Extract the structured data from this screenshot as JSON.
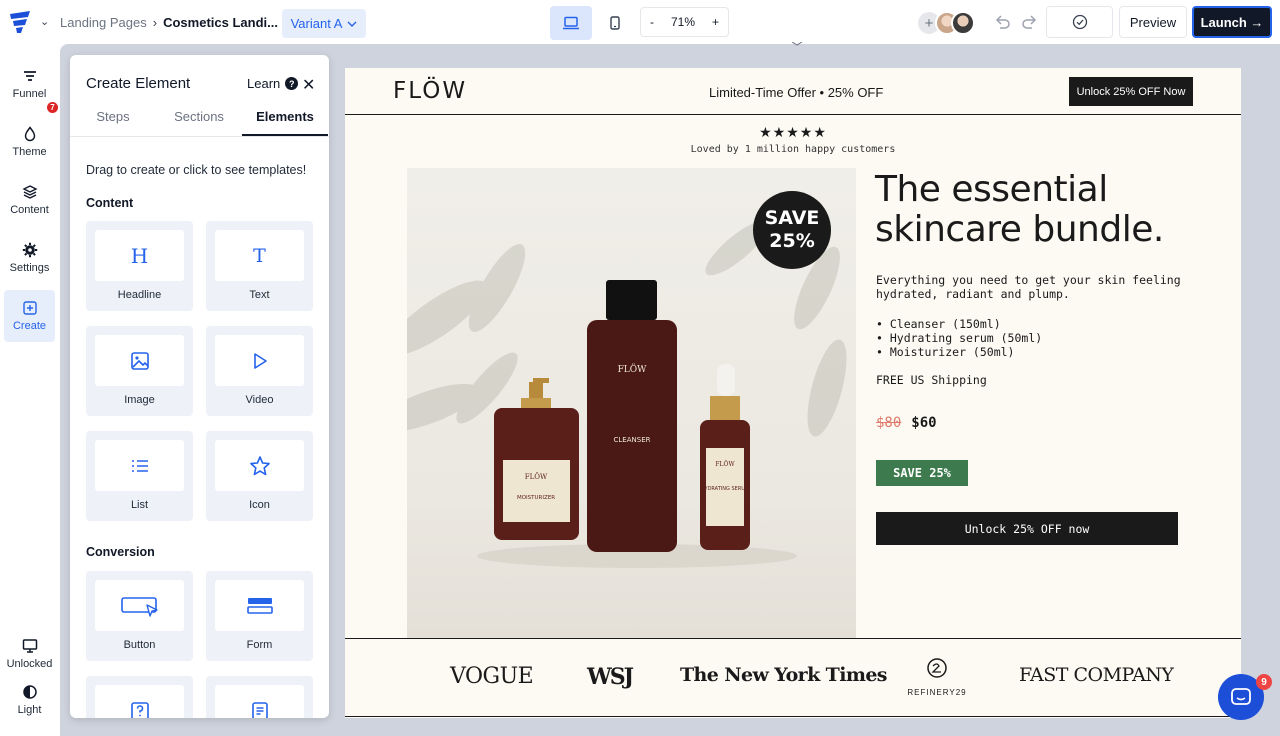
{
  "topbar": {
    "breadcrumb_parent": "Landing Pages",
    "breadcrumb_current": "Cosmetics Landi...",
    "variant_label": "Variant A",
    "zoom_minus": "-",
    "zoom_value": "71%",
    "zoom_plus": "+",
    "preview_label": "Preview",
    "launch_label": "Launch →"
  },
  "rail": {
    "items": [
      {
        "label": "Funnel",
        "icon": "funnel-icon",
        "badge": "7"
      },
      {
        "label": "Theme",
        "icon": "drop-icon"
      },
      {
        "label": "Content",
        "icon": "layers-icon"
      },
      {
        "label": "Settings",
        "icon": "gear-icon"
      },
      {
        "label": "Create",
        "icon": "plus-square-icon"
      }
    ],
    "bottom": [
      {
        "label": "Unlocked",
        "icon": "monitor-icon"
      },
      {
        "label": "Light",
        "icon": "contrast-icon"
      }
    ]
  },
  "panel": {
    "title": "Create Element",
    "learn_label": "Learn",
    "tabs": [
      "Steps",
      "Sections",
      "Elements"
    ],
    "active_tab": "Elements",
    "hint": "Drag to create or click to see templates!",
    "section_content": "Content",
    "section_conversion": "Conversion",
    "content_tiles": [
      "Headline",
      "Text",
      "Image",
      "Video",
      "List",
      "Icon"
    ],
    "conversion_tiles": [
      "Button",
      "Form"
    ]
  },
  "landing": {
    "brand": "FLÖW",
    "offer": "Limited-Time Offer • 25% OFF",
    "unlock_top": "Unlock 25% OFF Now",
    "stars": "★★★★★",
    "loved": "Loved by 1 million happy customers",
    "save_badge_line1": "SAVE",
    "save_badge_line2": "25%",
    "product_labels": [
      "FLÖW",
      "MOISTURIZER",
      "FLÖW",
      "CLEANSER",
      "FLÖW",
      "HYDRATING SERUM"
    ],
    "headline": "The essential skincare bundle.",
    "subtext": "Everything you need to get your skin feeling hydrated, radiant and plump.",
    "bullets": [
      "• Cleanser (150ml)",
      "• Hydrating serum (50ml)",
      "• Moisturizer (50ml)"
    ],
    "shipping": "FREE US Shipping",
    "old_price": "$80",
    "new_price": "$60",
    "save_tag": "SAVE 25%",
    "cta": "Unlock 25% OFF now",
    "press": [
      "VOGUE",
      "WSJ",
      "The New York Times",
      "REFINERY29",
      "FAST COMPANY"
    ]
  },
  "chat": {
    "badge": "9"
  },
  "colors": {
    "accent": "#2563eb",
    "dark": "#1a1a1a",
    "save_green": "#3d7a4d",
    "old_price": "#e07a6a",
    "page_bg": "#fcfaf3",
    "canvas_bg": "#cfd3dd"
  }
}
